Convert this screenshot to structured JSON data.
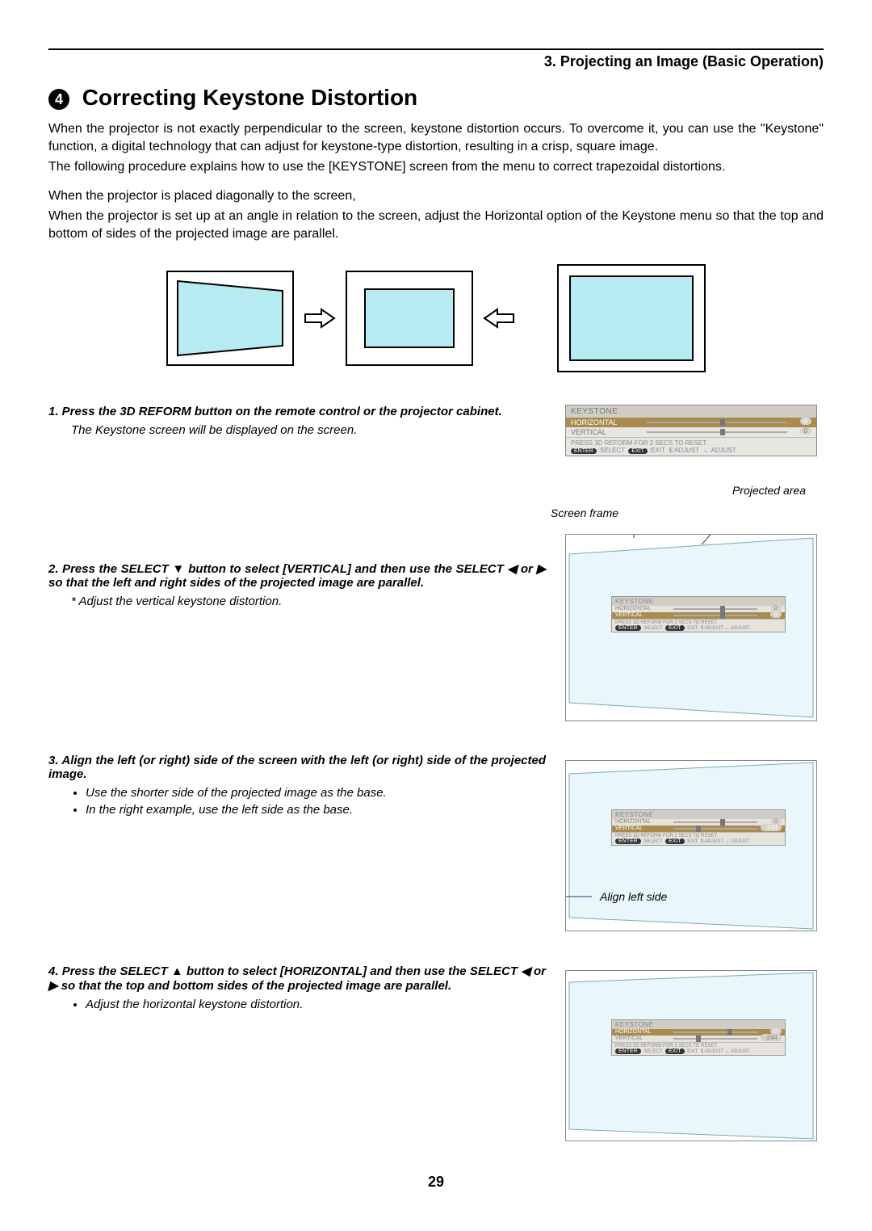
{
  "header": {
    "section": "3. Projecting an Image (Basic Operation)"
  },
  "title": {
    "number": "4",
    "text": "Correcting Keystone Distortion"
  },
  "intro": {
    "p1": "When the projector is not exactly perpendicular to the screen, keystone distortion occurs. To overcome it, you can use the \"Keystone\" function, a digital technology that can adjust for keystone-type distortion, resulting in a crisp, square image.",
    "p2": "The following procedure explains how to use the [KEYSTONE] screen from the menu to correct trapezoidal distortions.",
    "p3": "When the projector is placed diagonally to the screen,",
    "p4": "When the projector is set up at an angle in relation to the screen, adjust the Horizontal option of the Keystone menu so that the top and bottom of sides of the projected image are parallel."
  },
  "menu": {
    "title": "KEYSTONE",
    "horizontal": "HORIZONTAL",
    "vertical": "VERTICAL",
    "reset": "PRESS 3D REFORM FOR 2 SECS TO RESET.",
    "enter": "ENTER",
    "select": ":SELECT",
    "exit": "EXIT",
    "exitlabel": ":EXIT",
    "adjust1": "$:ADJUST",
    "adjust2": "↔:ADJUST",
    "value0": "0",
    "valneg": "-244"
  },
  "labels": {
    "projected_area": "Projected area",
    "screen_frame": "Screen frame",
    "align_left": "Align left side"
  },
  "steps": {
    "s1a": "1. Press the 3D REFORM button on the remote control or the projector cabinet.",
    "s1b": "The Keystone screen will be displayed on the screen.",
    "s2a": "2. Press the SELECT ▼ button to select [VERTICAL] and then use the SELECT ◀ or ▶ so that the left and right sides of the projected image are parallel.",
    "s2b": "* Adjust the vertical keystone distortion.",
    "s3a": "3. Align the left (or right) side of the screen with the left (or right) side of the projected image.",
    "s3b1": "Use the shorter side of the projected image as the base.",
    "s3b2": "In the right example, use the left side as the base.",
    "s4a": "4. Press the SELECT ▲ button to select [HORIZONTAL] and then use the SELECT ◀ or ▶ so that the top and bottom sides of the projected image are parallel.",
    "s4b": "Adjust the horizontal keystone distortion."
  },
  "page_number": "29"
}
